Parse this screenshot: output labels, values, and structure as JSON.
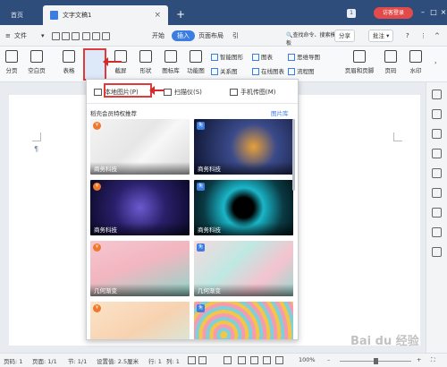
{
  "window": {
    "home_tab": "首页",
    "doc_tab": "文字文稿1",
    "badge": "1",
    "login_button": "访客登录"
  },
  "menu": {
    "file": "文件",
    "start": "开始",
    "insert": "插入",
    "layout": "页面布局",
    "ref": "引",
    "search": "查找命令、搜索模板",
    "share": "分享",
    "comment": "批注",
    "help": "?"
  },
  "ribbon": {
    "page_break": "分页",
    "blank_page": "空白页",
    "table": "表格",
    "picture": "图片",
    "screenshot": "截屏",
    "shape": "形状",
    "icon_lib": "图标库",
    "func_chart": "功能图",
    "smart_graphic": "智能图形",
    "chart": "图表",
    "relation": "关系图",
    "online_chart": "在线图表",
    "mind_map": "思维导图",
    "flowchart": "流程图",
    "header_footer": "页眉和页脚",
    "page_number": "页码",
    "watermark": "水印"
  },
  "dropdown": {
    "local_picture": "本地图片(P)",
    "scanner": "扫描仪(S)",
    "phone_picture": "手机传图(M)",
    "section_title": "稻壳会员特权推荐",
    "library_link": "图片库",
    "thumbs": [
      {
        "caption": "商务科技",
        "badge": "¥"
      },
      {
        "caption": "商务科技",
        "badge": "免"
      },
      {
        "caption": "商务科技",
        "badge": "¥"
      },
      {
        "caption": "商务科技",
        "badge": "免"
      },
      {
        "caption": "几何渐变",
        "badge": "¥"
      },
      {
        "caption": "几何渐变",
        "badge": "免"
      },
      {
        "caption": "",
        "badge": "¥"
      },
      {
        "caption": "",
        "badge": "免"
      }
    ]
  },
  "statusbar": {
    "page_no": "页码: 1",
    "page_total": "页面: 1/1",
    "section": "节: 1/1",
    "settings": "设置值: 2.5厘米",
    "row": "行: 1",
    "col": "列: 1",
    "zoom": "100%"
  },
  "watermark_text": "Bai du 经验",
  "colors": {
    "titlebar": "#2f4d7a",
    "accent": "#3b7de0",
    "highlight_red": "#e03a3a",
    "login_red": "#e34b4b"
  }
}
